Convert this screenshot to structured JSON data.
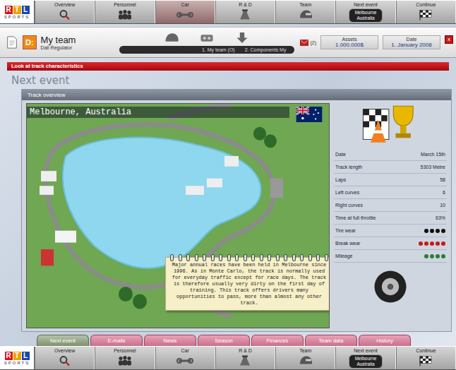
{
  "logo": {
    "top": "RTL",
    "bottom": "SPORTS"
  },
  "top_nav": [
    {
      "label": "Overview",
      "selected": false
    },
    {
      "label": "Personnel",
      "selected": false
    },
    {
      "label": "Car",
      "selected": true
    },
    {
      "label": "R & D",
      "selected": false
    },
    {
      "label": "Team",
      "selected": false
    },
    {
      "label": "Next event",
      "selected": false,
      "sub": [
        "Melbourne",
        "Australia"
      ]
    },
    {
      "label": "Continue",
      "selected": false
    }
  ],
  "header": {
    "logo_text": "D:",
    "title": "My team",
    "subtitle": "Dali Regulator",
    "strip": [
      "1. My team (O)",
      "2. Components My"
    ],
    "mail_count": "(2)",
    "assets_label": "Assets",
    "assets_value": "1.000.000$",
    "date_label": "Date",
    "date_value": "1. January 2008",
    "close": "x"
  },
  "section_bar": "Look at track characteristics",
  "section_title": "Next event",
  "panel": {
    "title": "Track overview",
    "map_title": "Melbourne, Australia",
    "note": "Major annual races have been held in Melbourne since 1996. As in Monte Carlo, the track is normally used for everyday traffic except for race days. The track is therefore usually very dirty on the first day of training. This track offers drivers many opportunities to pass, more than almost any other track.",
    "stats": [
      {
        "label": "Date",
        "kind": "text",
        "value": "March 15th"
      },
      {
        "label": "Track length",
        "kind": "text",
        "value": "5303 Metre"
      },
      {
        "label": "Laps",
        "kind": "text",
        "value": "58"
      },
      {
        "label": "Left curves",
        "kind": "text",
        "value": "6"
      },
      {
        "label": "Right curves",
        "kind": "text",
        "value": "10"
      },
      {
        "label": "Time at full throttle",
        "kind": "text",
        "value": "63%"
      },
      {
        "label": "Tire wear",
        "kind": "marks",
        "marks": 4,
        "color": "#111111"
      },
      {
        "label": "Break wear",
        "kind": "marks",
        "marks": 5,
        "color": "#c41a1a"
      },
      {
        "label": "Mileage",
        "kind": "marks",
        "marks": 4,
        "color": "#2e7d32"
      }
    ]
  },
  "tabs": [
    {
      "label": "Next event",
      "selected": true
    },
    {
      "label": "E-mails",
      "selected": false
    },
    {
      "label": "News",
      "selected": false
    },
    {
      "label": "Season",
      "selected": false
    },
    {
      "label": "Finances",
      "selected": false
    },
    {
      "label": "Team data",
      "selected": false
    },
    {
      "label": "History",
      "selected": false
    }
  ],
  "bottom_nav": [
    {
      "label": "Overview",
      "selected": false
    },
    {
      "label": "Personnel",
      "selected": false
    },
    {
      "label": "Car",
      "selected": false
    },
    {
      "label": "R & D",
      "selected": false
    },
    {
      "label": "Team",
      "selected": false
    },
    {
      "label": "Next event",
      "selected": false,
      "sub": [
        "Melbourne",
        "Australia"
      ]
    },
    {
      "label": "Continue",
      "selected": false
    }
  ]
}
